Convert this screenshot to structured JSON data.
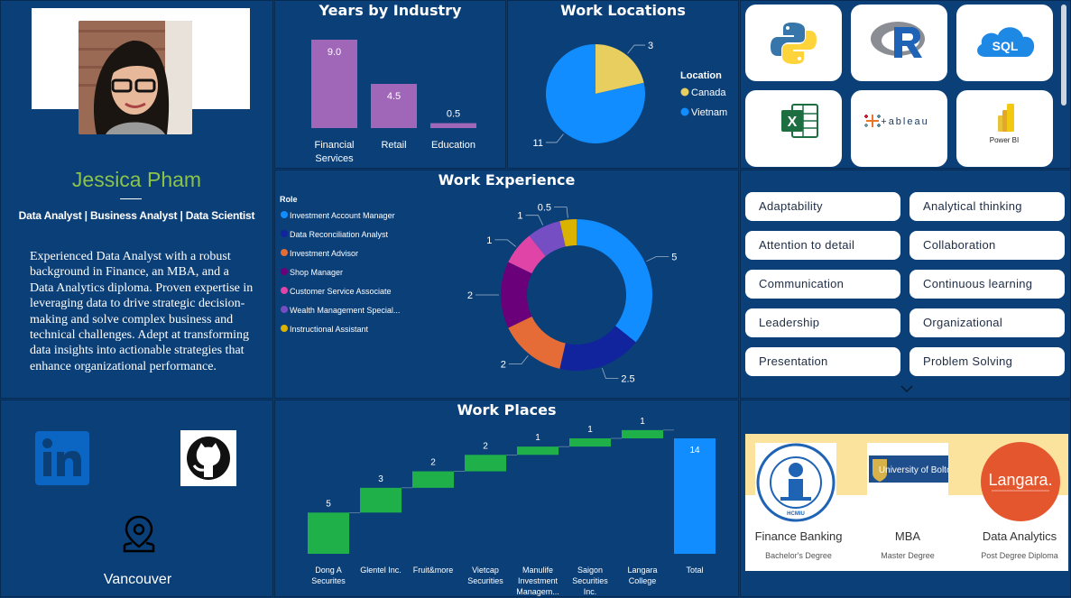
{
  "profile": {
    "name": "Jessica Pham",
    "roles": "Data Analyst | Business Analyst |  Data Scientist",
    "bio": "Experienced Data Analyst with a robust background in Finance, an MBA, and a Data Analytics diploma. Proven expertise in leveraging data to drive strategic decision-making and solve complex business and technical challenges. Adept at transforming data insights into actionable strategies that enhance organizational performance."
  },
  "contact": {
    "icons": [
      "linkedin-icon",
      "github-icon",
      "location-pin-icon"
    ],
    "city": "Vancouver"
  },
  "colors": {
    "background": "#0b3f78",
    "name_green": "#8bc34a",
    "bar_purple": "#a066b8",
    "waterfall_green": "#1fb04a",
    "total_blue": "#118dff"
  },
  "tools": [
    {
      "name": "python-logo",
      "label": ""
    },
    {
      "name": "r-logo",
      "label": ""
    },
    {
      "name": "sql-logo",
      "label": "SQL"
    },
    {
      "name": "excel-logo",
      "label": "X"
    },
    {
      "name": "tableau-logo",
      "label": "+ableau"
    },
    {
      "name": "power-bi-logo",
      "label": "Power BI"
    }
  ],
  "skills": [
    "Adaptability",
    "Analytical thinking",
    "Attention to detail",
    "Collaboration",
    "Communication",
    "Continuous learning",
    "Leadership",
    "Organizational",
    "Presentation",
    "Problem Solving"
  ],
  "education": [
    {
      "field": "Finance Banking",
      "degree": "Bachelor's Degree",
      "logo_text": "HCMIU"
    },
    {
      "field": "MBA",
      "degree": "Master Degree",
      "logo_text": "University of Bolton"
    },
    {
      "field": "Data Analytics",
      "degree": "Post Degree Diploma",
      "logo_text": "Langara."
    }
  ],
  "chart_data": [
    {
      "type": "bar",
      "title": "Years by Industry",
      "categories": [
        "Financial Services",
        "Retail",
        "Education"
      ],
      "values": [
        9.0,
        4.5,
        0.5
      ],
      "value_labels": [
        "9.0",
        "4.5",
        "0.5"
      ]
    },
    {
      "type": "pie",
      "title": "Work Locations",
      "legend_title": "Location",
      "legend_position": "right",
      "labels": [
        "Canada",
        "Vietnam"
      ],
      "values": [
        3,
        11
      ],
      "colors": [
        "#e8cd5f",
        "#118dff"
      ]
    },
    {
      "type": "pie",
      "title": "Work Experience",
      "legend_title": "Role",
      "legend_position": "left",
      "labels": [
        "Investment Account Manager",
        "Data Reconciliation Analyst",
        "Investment Advisor",
        "Shop Manager",
        "Customer Service Associate",
        "Wealth Management Special...",
        "Instructional Assistant"
      ],
      "values": [
        5,
        2.5,
        2,
        2,
        1,
        1,
        0.5
      ],
      "value_labels": [
        "5",
        "2.5",
        "2",
        "2",
        "1",
        "1",
        "0.5"
      ],
      "colors": [
        "#118dff",
        "#12239e",
        "#e66c37",
        "#6b007b",
        "#e044a7",
        "#744ec2",
        "#d9b300"
      ]
    },
    {
      "type": "bar",
      "subtype": "waterfall",
      "title": "Work Places",
      "categories": [
        "Dong A Securites",
        "Glentel Inc.",
        "Fruit&more",
        "Vietcap Securities",
        "Manulife Investment Managem...",
        "Saigon Securities Inc.",
        "Langara College",
        "Total"
      ],
      "values": [
        5,
        3,
        2,
        2,
        1,
        1,
        1,
        14
      ],
      "value_labels": [
        "5",
        "3",
        "2",
        "2",
        "1",
        "1",
        "1",
        "14"
      ],
      "ylim": [
        0,
        14
      ]
    }
  ]
}
